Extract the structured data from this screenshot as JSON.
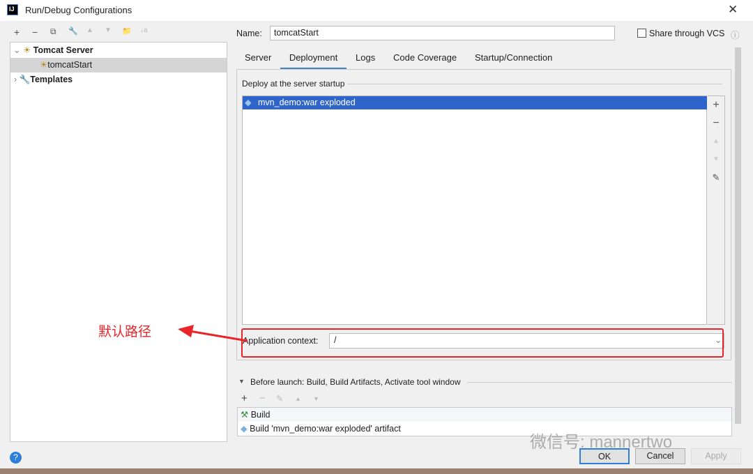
{
  "window": {
    "title": "Run/Debug Configurations",
    "logo": "IJ"
  },
  "toolbar": [
    "+",
    "−",
    "⧉",
    "🔧",
    "▲",
    "▼",
    "📁",
    "↓a"
  ],
  "tree": {
    "tomcat_server": "Tomcat Server",
    "tomcat_start": "tomcatStart",
    "templates": "Templates"
  },
  "name_label": "Name:",
  "name_value": "tomcatStart",
  "share_label": "Share through VCS",
  "tabs": [
    "Server",
    "Deployment",
    "Logs",
    "Code Coverage",
    "Startup/Connection"
  ],
  "deploy": {
    "heading": "Deploy at the server startup",
    "items": [
      "mvn_demo:war exploded"
    ]
  },
  "context": {
    "label": "Application context:",
    "value": "/"
  },
  "annotation": "默认路径",
  "before_launch": {
    "heading": "Before launch: Build, Build Artifacts, Activate tool window",
    "items": [
      "Build",
      "Build 'mvn_demo:war exploded' artifact"
    ]
  },
  "watermark": "微信号: mannertwo",
  "buttons": {
    "ok": "OK",
    "cancel": "Cancel",
    "apply": "Apply"
  },
  "help": "?",
  "colors": {
    "accent": "#2f65ca",
    "annotation": "#e8262a"
  }
}
